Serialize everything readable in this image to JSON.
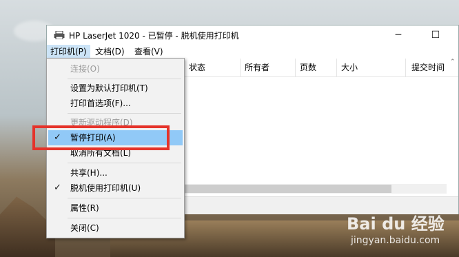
{
  "window": {
    "title": "HP LaserJet 1020 - 已暂停 - 脱机使用打印机",
    "minimize": "─",
    "maximize": "☐"
  },
  "menubar": {
    "printer": "打印机(P)",
    "document": "文档(D)",
    "view": "查看(V)"
  },
  "columns": [
    "状态",
    "所有者",
    "页数",
    "大小",
    "提交时间"
  ],
  "context_menu": {
    "items": [
      {
        "label": "连接(O)",
        "disabled": true
      },
      {
        "label": "设置为默认打印机(T)"
      },
      {
        "label": "打印首选项(F)..."
      },
      {
        "label": "更新驱动程序(D)",
        "disabled": true
      },
      {
        "label": "暂停打印(A)",
        "checked": true,
        "highlighted": true
      },
      {
        "label": "取消所有文档(L)"
      },
      {
        "label": "共享(H)..."
      },
      {
        "label": "脱机使用打印机(U)",
        "checked": true
      },
      {
        "label": "属性(R)"
      },
      {
        "label": "关闭(C)"
      }
    ],
    "check_glyph": "✓"
  },
  "annotation": {
    "highlight_color": "#e5332a"
  },
  "watermark": {
    "logo_text": "Bai du 经验",
    "url": "jingyan.baidu.com"
  }
}
